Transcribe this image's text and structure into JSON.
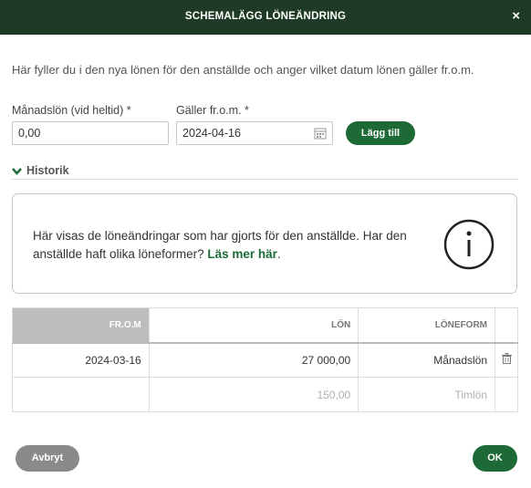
{
  "dialog": {
    "title": "SCHEMALÄGG LÖNEÄNDRING",
    "close_icon": "×"
  },
  "intro": "Här fyller du i den nya lönen för den anställde och anger vilket datum lönen gäller fr.o.m.",
  "form": {
    "salary_label": "Månadslön (vid heltid) *",
    "salary_value": "0,00",
    "date_label": "Gäller fr.o.m. *",
    "date_value": "2024-04-16",
    "add_label": "Lägg till"
  },
  "history": {
    "label": "Historik",
    "info_text": "Här visas de löneändringar som har gjorts för den anställde. Har den anställde haft olika löneformer?",
    "info_link": "Läs mer här",
    "info_suffix": "."
  },
  "table": {
    "headers": [
      "FR.O.M",
      "LÖN",
      "LÖNEFORM"
    ],
    "rows": [
      {
        "from": "2024-03-16",
        "salary": "27 000,00",
        "form": "Månadslön"
      },
      {
        "from": "",
        "salary": "150,00",
        "form": "Timlön"
      }
    ]
  },
  "actions": {
    "cancel": "Avbryt",
    "ok": "OK"
  },
  "colors": {
    "header_bg": "#1f3a26",
    "accent": "#1d6a37",
    "cancel_bg": "#8a8a8a"
  }
}
